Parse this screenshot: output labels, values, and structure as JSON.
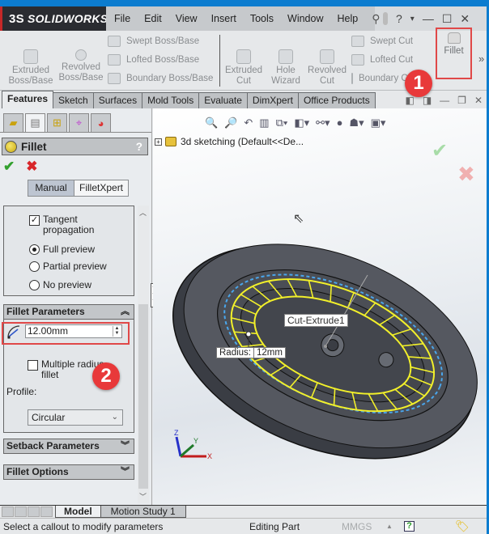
{
  "app": {
    "logo_prefix": "3S",
    "logo_text": "SOLIDWORKS"
  },
  "menu": [
    "File",
    "Edit",
    "View",
    "Insert",
    "Tools",
    "Window",
    "Help"
  ],
  "window_controls": {
    "help": "?",
    "dropdown": "▾",
    "minimize": "—",
    "maximize": "☐",
    "close": "✕"
  },
  "ribbon": {
    "extruded_boss": "Extruded\nBoss/Base",
    "revolved_boss": "Revolved\nBoss/Base",
    "swept_boss": "Swept Boss/Base",
    "lofted_boss": "Lofted Boss/Base",
    "boundary_boss": "Boundary Boss/Base",
    "extruded_cut": "Extruded\nCut",
    "hole_wizard": "Hole\nWizard",
    "revolved_cut": "Revolved\nCut",
    "swept_cut": "Swept Cut",
    "lofted_cut": "Lofted Cut",
    "boundary_cut": "Boundary Cut",
    "fillet": "Fillet",
    "more": "»"
  },
  "tabs": [
    "Features",
    "Sketch",
    "Surfaces",
    "Mold Tools",
    "Evaluate",
    "DimXpert",
    "Office Products"
  ],
  "annotations": {
    "badge1": "1",
    "badge2": "2",
    "highlight_color": "#e04848"
  },
  "property_manager": {
    "title": "Fillet",
    "help": "?",
    "ok": "✔",
    "cancel": "✖",
    "mode_manual": "Manual",
    "mode_xpert": "FilletXpert",
    "tangent_propagation": "Tangent propagation",
    "tangent_checked": true,
    "preview_options": [
      {
        "label": "Full preview",
        "selected": true
      },
      {
        "label": "Partial preview",
        "selected": false
      },
      {
        "label": "No preview",
        "selected": false
      }
    ],
    "fillet_parameters": "Fillet Parameters",
    "radius_value": "12.00mm",
    "multiple_radius": "Multiple radius fillet",
    "profile_label": "Profile:",
    "profile_value": "Circular",
    "setback_parameters": "Setback Parameters",
    "fillet_options": "Fillet Options"
  },
  "viewport": {
    "tree_item": "3d sketching  (Default<<De...",
    "callout_feature": "Cut-Extrude1",
    "radius_label": "Radius:",
    "radius_value": "12mm",
    "triad": {
      "x": "X",
      "y": "Y",
      "z": "Z"
    }
  },
  "bottom_tabs": [
    "Model",
    "Motion Study 1"
  ],
  "status": {
    "message": "Select a callout to modify parameters",
    "mode": "Editing Part",
    "units": "MMGS",
    "help_icon": "?"
  }
}
